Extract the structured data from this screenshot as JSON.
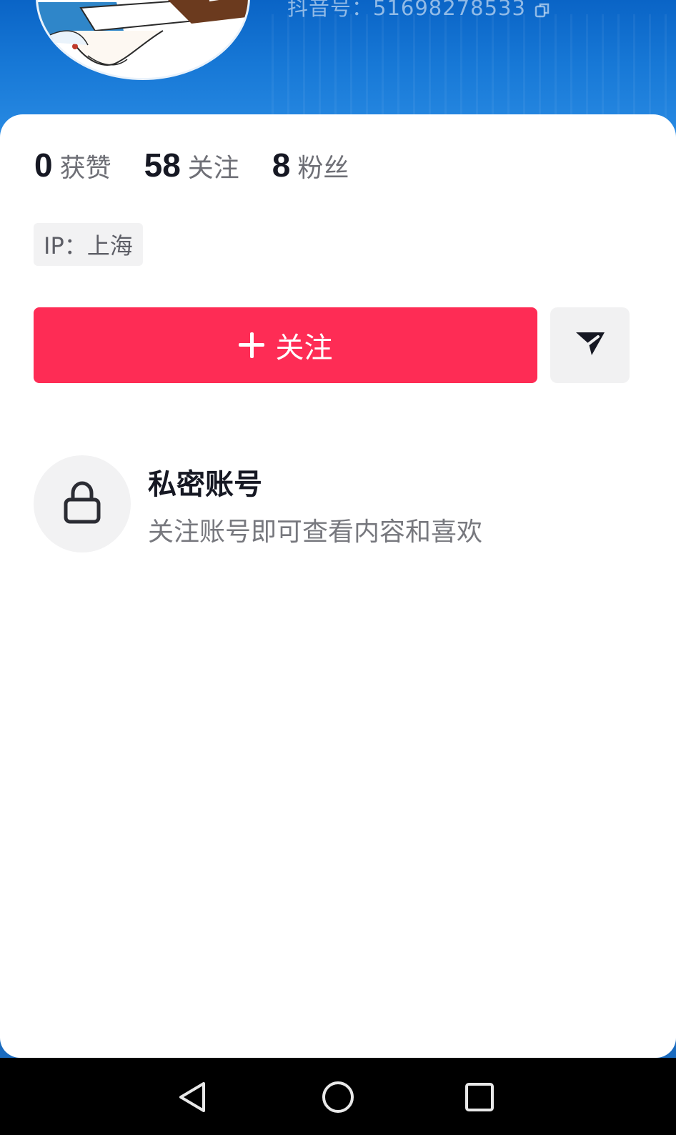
{
  "header": {
    "douyin_id": "抖音号：51698278533"
  },
  "stats": [
    {
      "value": "0",
      "label": "获赞"
    },
    {
      "value": "58",
      "label": "关注"
    },
    {
      "value": "8",
      "label": "粉丝"
    }
  ],
  "ip_tag": "IP：上海",
  "actions": {
    "follow_label": "关注",
    "share_icon": "send-icon"
  },
  "private_account": {
    "icon": "lock-icon",
    "title": "私密账号",
    "description": "关注账号即可查看内容和喜欢"
  },
  "colors": {
    "header_blue": "#1778d6",
    "follow_red": "#fe2c55",
    "text_primary": "#161823",
    "text_secondary": "#6e6f76",
    "tag_bg": "#f2f2f3"
  },
  "navbar": {
    "icons": [
      "back-icon",
      "home-icon",
      "recents-icon"
    ]
  }
}
